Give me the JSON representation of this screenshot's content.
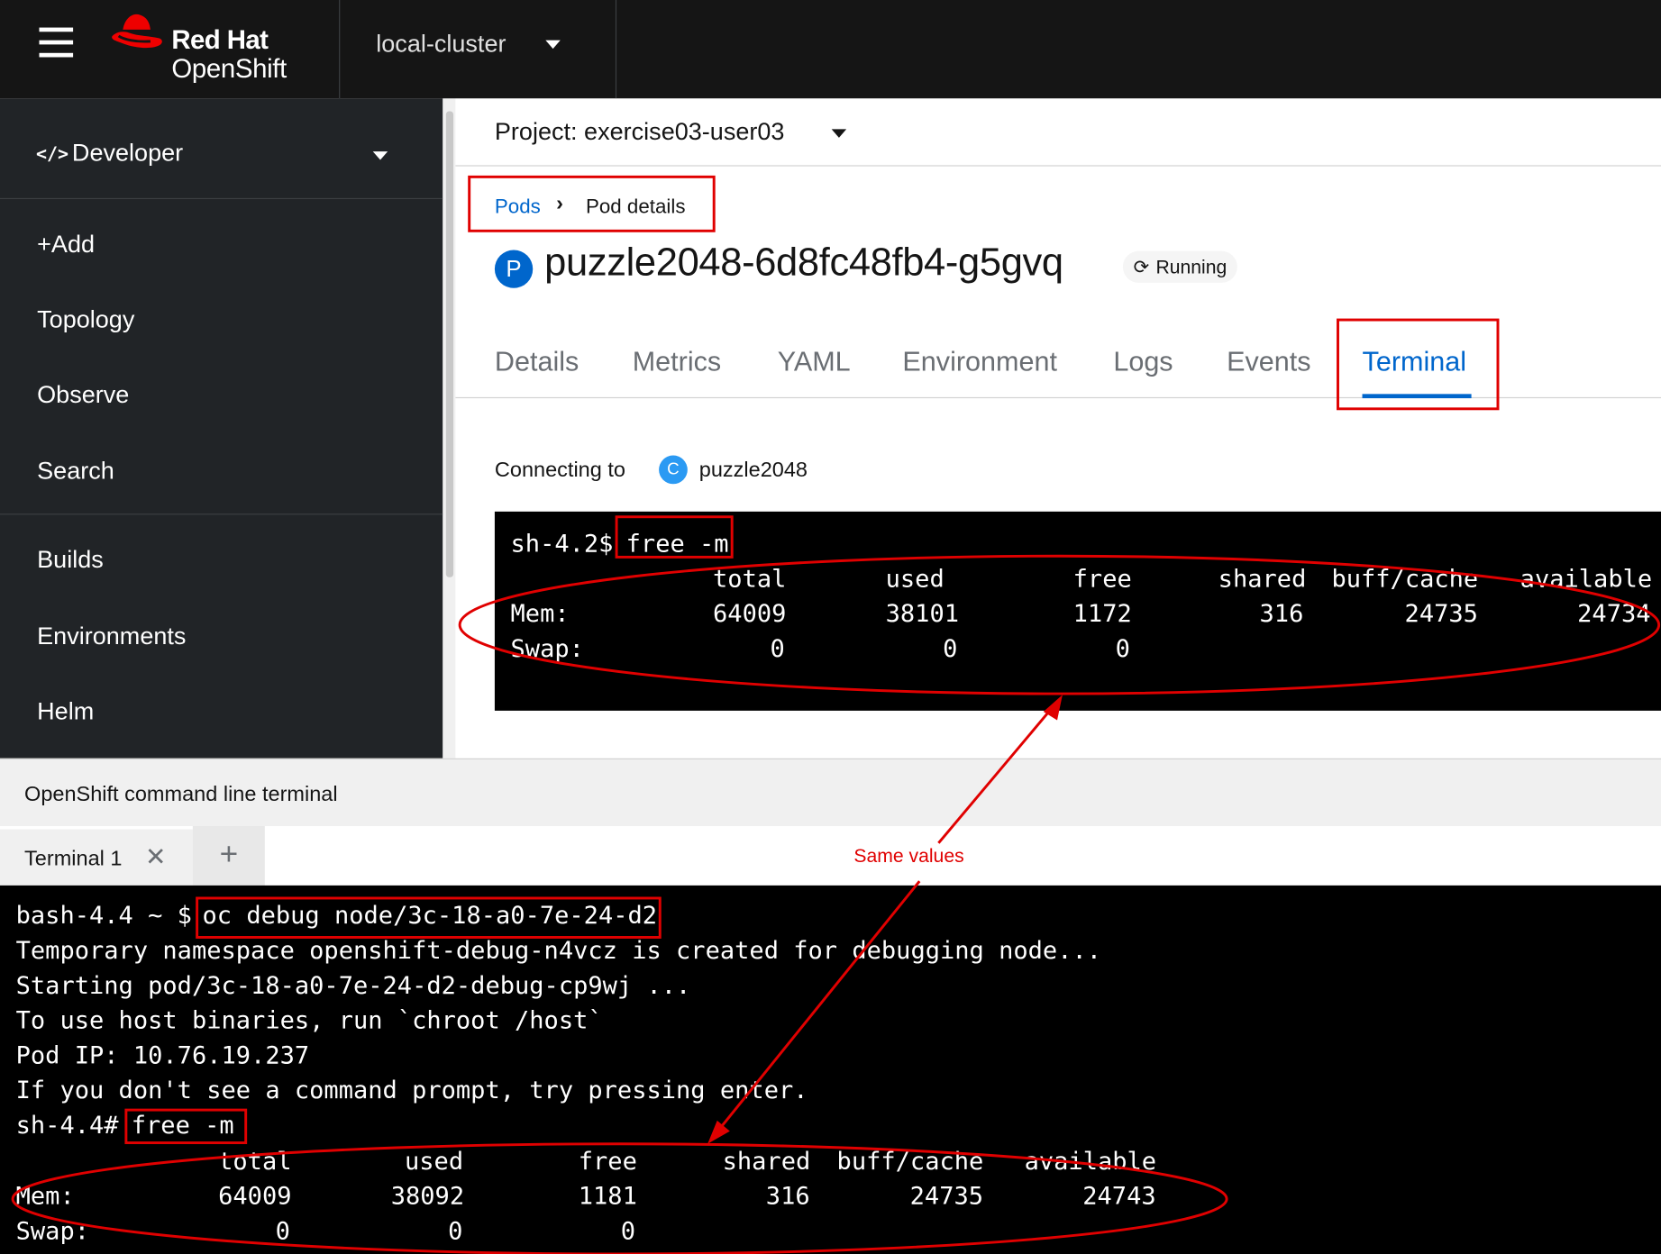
{
  "masthead": {
    "brand_line1": "Red Hat",
    "brand_line2": "OpenShift",
    "cluster": "local-cluster"
  },
  "sidebar": {
    "perspective_icon": "</>",
    "perspective": "Developer",
    "items": [
      {
        "label": "+Add"
      },
      {
        "label": "Topology"
      },
      {
        "label": "Observe"
      },
      {
        "label": "Search"
      },
      {
        "label": "Builds"
      },
      {
        "label": "Environments"
      },
      {
        "label": "Helm"
      }
    ]
  },
  "main": {
    "project": "Project: exercise03-user03",
    "breadcrumb": {
      "parent": "Pods",
      "current": "Pod details"
    },
    "pod_badge": "P",
    "pod_name": "puzzle2048-6d8fc48fb4-g5gvq",
    "status": "Running",
    "tabs": [
      {
        "label": "Details"
      },
      {
        "label": "Metrics"
      },
      {
        "label": "YAML"
      },
      {
        "label": "Environment"
      },
      {
        "label": "Logs"
      },
      {
        "label": "Events"
      },
      {
        "label": "Terminal"
      }
    ],
    "connecting_label": "Connecting to",
    "container_badge": "C",
    "container": "puzzle2048",
    "terminal": {
      "prompt": "sh-4.2$ ",
      "command": "free -m",
      "header": [
        "total",
        "used",
        "free",
        "shared",
        "buff/cache",
        "available"
      ],
      "mem": [
        "Mem:",
        "64009",
        "38101",
        "1172",
        "316",
        "24735",
        "24734"
      ],
      "swap": [
        "Swap:",
        "0",
        "0",
        "0"
      ]
    }
  },
  "cli": {
    "title": "OpenShift command line terminal",
    "tab": "Terminal 1",
    "close_glyph": "✕",
    "add_glyph": "+",
    "prompt1": "bash-4.4 ~ $ ",
    "command1": "oc debug node/3c-18-a0-7e-24-d2",
    "lines": [
      "Temporary namespace openshift-debug-n4vcz is created for debugging node...",
      "Starting pod/3c-18-a0-7e-24-d2-debug-cp9wj ...",
      "To use host binaries, run `chroot /host`",
      "Pod IP: 10.76.19.237",
      "If you don't see a command prompt, try pressing enter."
    ],
    "prompt2": "sh-4.4# ",
    "command2": "free -m",
    "header": [
      "total",
      "used",
      "free",
      "shared",
      "buff/cache",
      "available"
    ],
    "mem": [
      "Mem:",
      "64009",
      "38092",
      "1181",
      "316",
      "24735",
      "24743"
    ],
    "swap": [
      "Swap:",
      "0",
      "0",
      "0"
    ]
  },
  "annotation": {
    "text": "Same values",
    "color": "#e00000"
  },
  "colors": {
    "masthead": "#151515",
    "sidebar": "#212427",
    "link": "#0066cc",
    "brand_red": "#ee0000"
  }
}
